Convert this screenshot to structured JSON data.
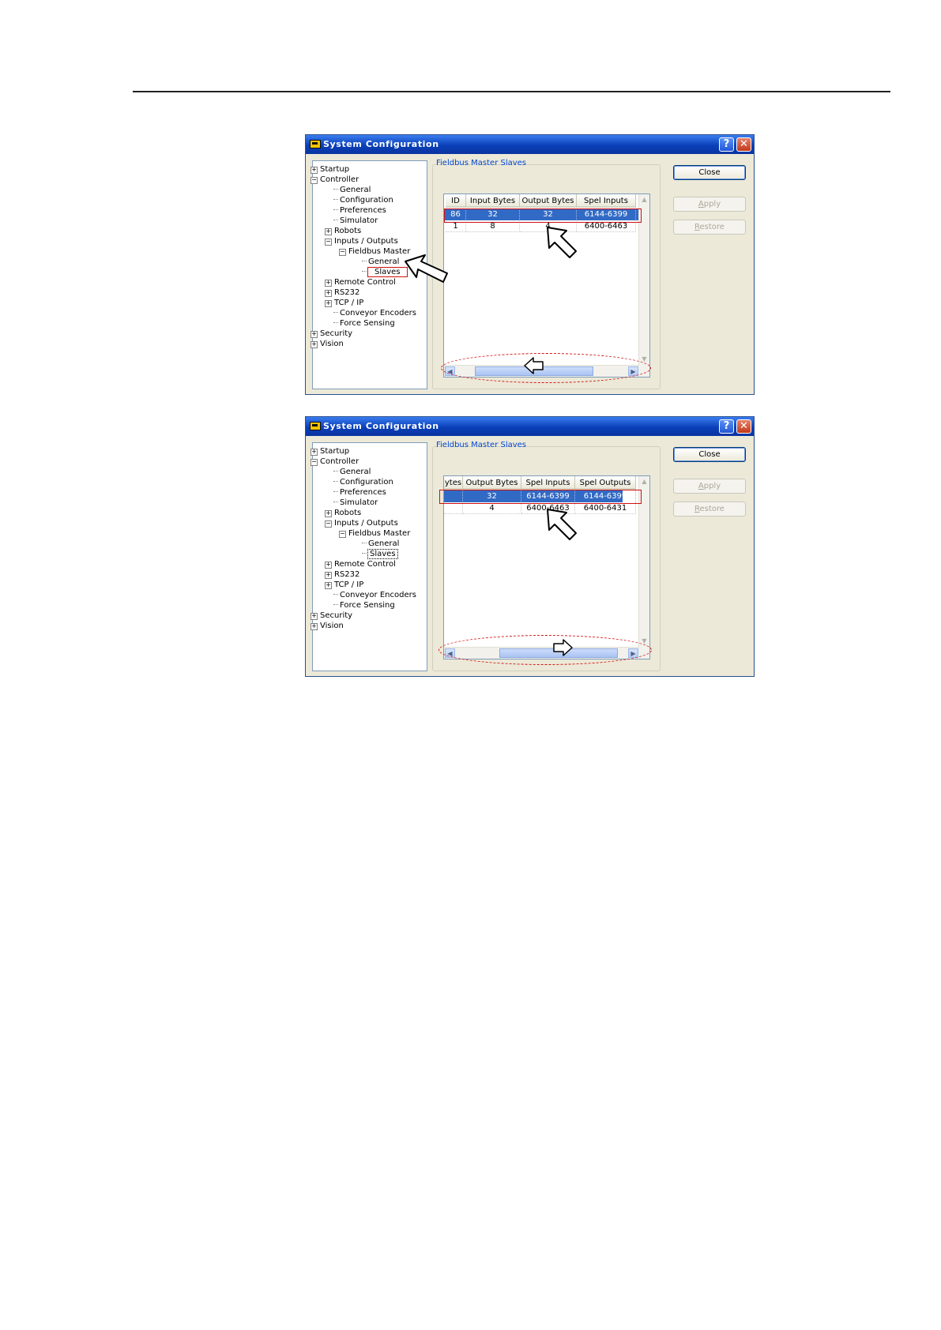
{
  "dialogs": [
    {
      "title": "System Configuration",
      "help_glyph": "?",
      "close_glyph": "✕",
      "group_title": "Fieldbus Master Slaves",
      "tree": [
        {
          "label": "Startup",
          "exp": "+"
        },
        {
          "label": "Controller",
          "exp": "−"
        },
        {
          "label": "General"
        },
        {
          "label": "Configuration"
        },
        {
          "label": "Preferences"
        },
        {
          "label": "Simulator"
        },
        {
          "label": "Robots",
          "exp": "+"
        },
        {
          "label": "Inputs / Outputs",
          "exp": "−"
        },
        {
          "label": "Fieldbus Master",
          "exp": "−"
        },
        {
          "label": "General"
        },
        {
          "label": "Slaves",
          "state": "highlighted"
        },
        {
          "label": "Remote Control",
          "exp": "+"
        },
        {
          "label": "RS232",
          "exp": "+"
        },
        {
          "label": "TCP / IP",
          "exp": "+"
        },
        {
          "label": "Conveyor Encoders"
        },
        {
          "label": "Force Sensing"
        },
        {
          "label": "Security",
          "exp": "+"
        },
        {
          "label": "Vision",
          "exp": "+"
        }
      ],
      "columns": [
        "ID",
        "Input Bytes",
        "Output Bytes",
        "Spel Inputs"
      ],
      "rows": [
        [
          "86",
          "32",
          "32",
          "6144-6399"
        ],
        [
          "1",
          "8",
          "4",
          "6400-6463"
        ]
      ],
      "selected_row": 0,
      "scroll_position": 0.45,
      "buttons": {
        "close": "Close",
        "apply": "Apply",
        "restore": "Restore"
      }
    },
    {
      "title": "System Configuration",
      "help_glyph": "?",
      "close_glyph": "✕",
      "group_title": "Fieldbus Master Slaves",
      "tree": [
        {
          "label": "Startup",
          "exp": "+"
        },
        {
          "label": "Controller",
          "exp": "−"
        },
        {
          "label": "General"
        },
        {
          "label": "Configuration"
        },
        {
          "label": "Preferences"
        },
        {
          "label": "Simulator"
        },
        {
          "label": "Robots",
          "exp": "+"
        },
        {
          "label": "Inputs / Outputs",
          "exp": "−"
        },
        {
          "label": "Fieldbus Master",
          "exp": "−"
        },
        {
          "label": "General"
        },
        {
          "label": "Slaves",
          "state": "selected"
        },
        {
          "label": "Remote Control",
          "exp": "+"
        },
        {
          "label": "RS232",
          "exp": "+"
        },
        {
          "label": "TCP / IP",
          "exp": "+"
        },
        {
          "label": "Conveyor Encoders"
        },
        {
          "label": "Force Sensing"
        },
        {
          "label": "Security",
          "exp": "+"
        },
        {
          "label": "Vision",
          "exp": "+"
        }
      ],
      "columns": [
        "ytes",
        "Output Bytes",
        "Spel Inputs",
        "Spel Outputs"
      ],
      "rows": [
        [
          "",
          "32",
          "6144-6399",
          "6144-6399"
        ],
        [
          "",
          "4",
          "6400-6463",
          "6400-6431"
        ]
      ],
      "selected_row": 0,
      "scroll_position": 1.0,
      "buttons": {
        "close": "Close",
        "apply": "Apply",
        "restore": "Restore"
      }
    }
  ]
}
